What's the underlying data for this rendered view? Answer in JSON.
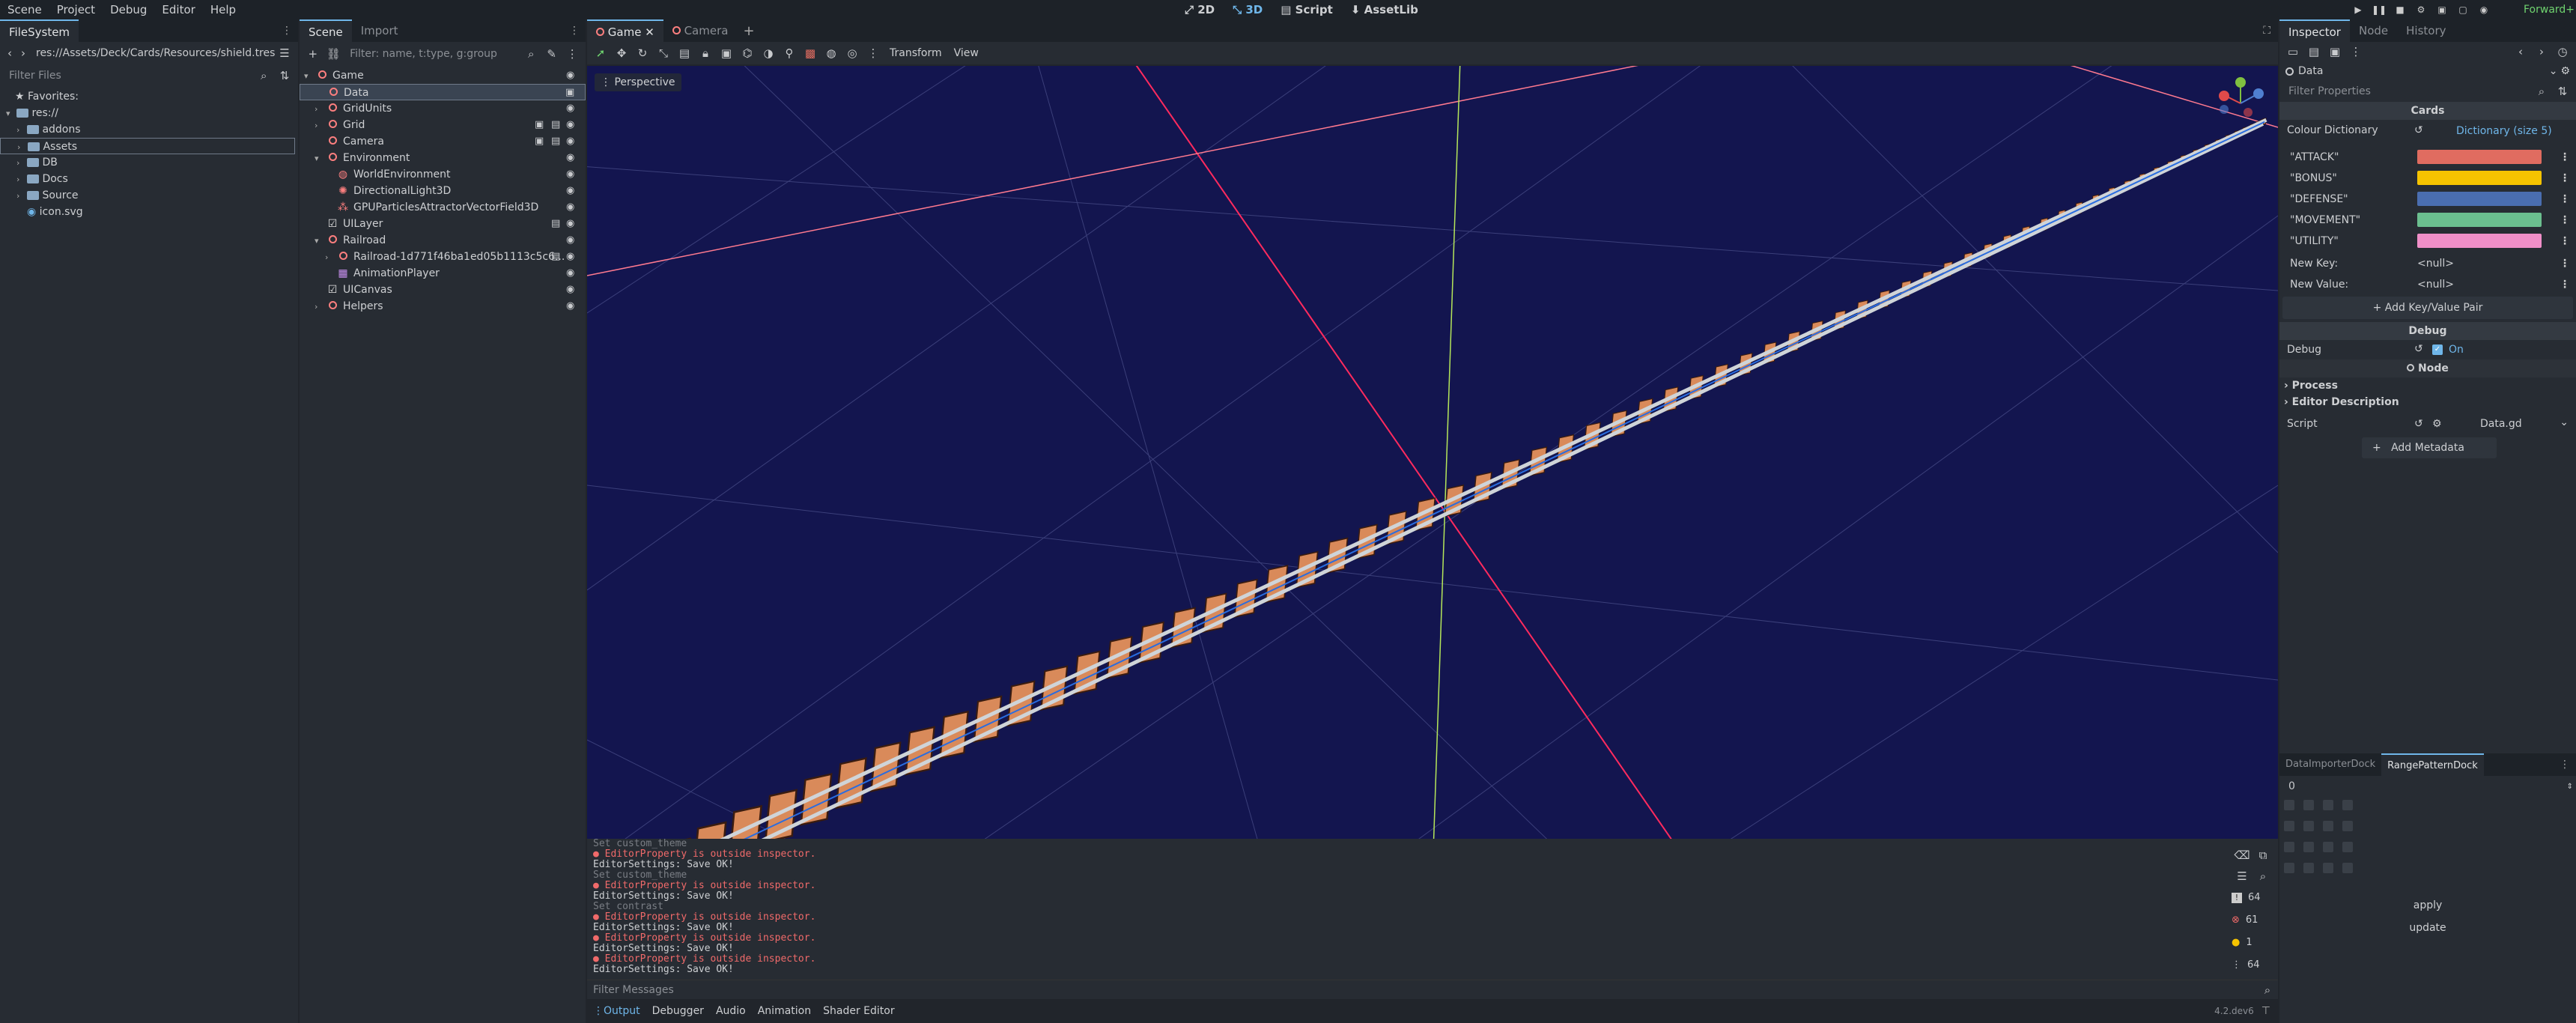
{
  "menu": [
    "Scene",
    "Project",
    "Debug",
    "Editor",
    "Help"
  ],
  "main_screens": [
    {
      "label": "2D",
      "icon": "2d-icon"
    },
    {
      "label": "3D",
      "icon": "3d-icon",
      "active": true
    },
    {
      "label": "Script",
      "icon": "script-icon"
    },
    {
      "label": "AssetLib",
      "icon": "assetlib-icon"
    }
  ],
  "renderer": "Forward+",
  "filesystem": {
    "tab": "FileSystem",
    "path": "res://Assets/Deck/Cards/Resources/shield.tres",
    "filter_placeholder": "Filter Files",
    "favorites": "Favorites:",
    "root": "res://",
    "items": [
      "addons",
      "Assets",
      "DB",
      "Docs",
      "Source",
      "icon.svg"
    ]
  },
  "scene": {
    "tabs": [
      "Scene",
      "Import"
    ],
    "filter_placeholder": "Filter: name, t:type, g:group",
    "nodes": [
      {
        "name": "Game",
        "depth": 0
      },
      {
        "name": "Data",
        "depth": 1
      },
      {
        "name": "GridUnits",
        "depth": 1
      },
      {
        "name": "Grid",
        "depth": 1
      },
      {
        "name": "Camera",
        "depth": 1
      },
      {
        "name": "Environment",
        "depth": 1
      },
      {
        "name": "WorldEnvironment",
        "depth": 2
      },
      {
        "name": "DirectionalLight3D",
        "depth": 2
      },
      {
        "name": "GPUParticlesAttractorVectorField3D",
        "depth": 2
      },
      {
        "name": "UILayer",
        "depth": 1
      },
      {
        "name": "Railroad",
        "depth": 1
      },
      {
        "name": "Railroad-1d771f46ba1ed05b1113c5c6...",
        "depth": 2
      },
      {
        "name": "AnimationPlayer",
        "depth": 2
      },
      {
        "name": "UICanvas",
        "depth": 1
      },
      {
        "name": "Helpers",
        "depth": 1
      }
    ]
  },
  "editor_tabs": [
    "Game",
    "Camera"
  ],
  "viewport": {
    "toolbar": [
      "Transform",
      "View"
    ],
    "perspective": "Perspective"
  },
  "output": {
    "lines": [
      {
        "t": "Set custom_theme",
        "c": "dim"
      },
      {
        "t": "● EditorProperty is outside inspector.",
        "c": "err"
      },
      {
        "t": "EditorSettings: Save OK!",
        "c": ""
      },
      {
        "t": "Set custom_theme",
        "c": "dim"
      },
      {
        "t": "● EditorProperty is outside inspector.",
        "c": "err"
      },
      {
        "t": "EditorSettings: Save OK!",
        "c": ""
      },
      {
        "t": "Set contrast",
        "c": "dim"
      },
      {
        "t": "● EditorProperty is outside inspector.",
        "c": "err"
      },
      {
        "t": "EditorSettings: Save OK!",
        "c": ""
      },
      {
        "t": "● EditorProperty is outside inspector.",
        "c": "err"
      },
      {
        "t": "EditorSettings: Save OK!",
        "c": ""
      },
      {
        "t": "● EditorProperty is outside inspector.",
        "c": "err"
      },
      {
        "t": "EditorSettings: Save OK!",
        "c": ""
      }
    ],
    "filter_placeholder": "Filter Messages",
    "counts": {
      "messages": "64",
      "errors": "61",
      "warnings": "1",
      "info": "64"
    },
    "bottom_tabs": [
      "Output",
      "Debugger",
      "Audio",
      "Animation",
      "Shader Editor"
    ],
    "version": "4.2.dev6"
  },
  "inspector": {
    "tabs": [
      "Inspector",
      "Node",
      "History"
    ],
    "object": "Data",
    "filter_placeholder": "Filter Properties",
    "section_cards": "Cards",
    "colour_dictionary_label": "Colour Dictionary",
    "colour_dictionary_value": "Dictionary (size 5)",
    "entries": [
      {
        "key": "\"ATTACK\"",
        "color": "#e06c60"
      },
      {
        "key": "\"BONUS\"",
        "color": "#f5c300"
      },
      {
        "key": "\"DEFENSE\"",
        "color": "#4a6eb0"
      },
      {
        "key": "\"MOVEMENT\"",
        "color": "#6bbf8f"
      },
      {
        "key": "\"UTILITY\"",
        "color": "#f08fc8"
      }
    ],
    "new_key_label": "New Key:",
    "new_key_value": "<null>",
    "new_value_label": "New Value:",
    "new_value_value": "<null>",
    "add_pair": "Add Key/Value Pair",
    "section_debug": "Debug",
    "debug_label": "Debug",
    "debug_value": "On",
    "section_node": "Node",
    "process": "Process",
    "editor_description": "Editor Description",
    "script_label": "Script",
    "script_value": "Data.gd",
    "add_metadata": "Add Metadata"
  },
  "bottom_dock": {
    "tabs": [
      "DataImporterDock",
      "RangePatternDock"
    ],
    "spin_value": "0",
    "apply": "apply",
    "update": "update"
  }
}
